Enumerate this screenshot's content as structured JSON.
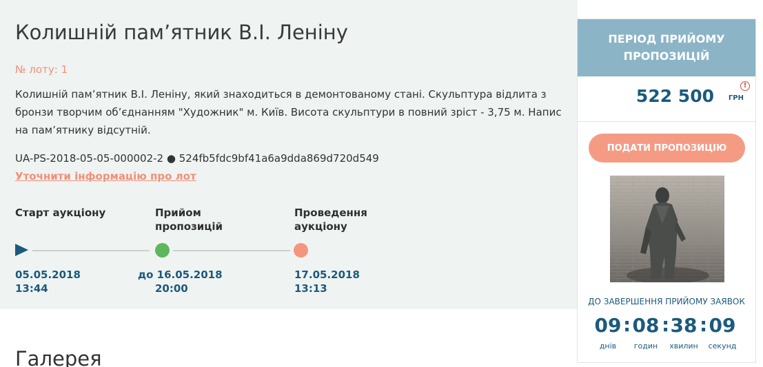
{
  "lot": {
    "title": "Колишній пам’ятник В.І. Леніну",
    "number_text": "№ лоту: 1",
    "description": "Колишній пам’ятник В.І. Леніну, який знаходиться в демонтованому стані. Скульптура відлита з бронзи творчим об’єднанням \"Художник\" м. Київ. Висота скульптури в повний зріст - 3,75 м. Напис на пам’ятнику відсутній.",
    "ids_text": "UA-PS-2018-05-05-000002-2 ● 524fb5fdc9bf41a6a9dda869d720d549",
    "clarify_link": "Уточнити інформацію про лот"
  },
  "timeline": {
    "steps": [
      {
        "label": "Старт аукціону",
        "date": "05.05.2018",
        "time": "13:44",
        "color": "#1b5a7c",
        "icon": "play-icon"
      },
      {
        "label": "Прийом пропозицій",
        "date": "до 16.05.2018",
        "time": "20:00",
        "color": "#5cb85c",
        "icon": "dot-icon"
      },
      {
        "label": "Проведення аукціону",
        "date": "17.05.2018",
        "time": "13:13",
        "color": "#f5957d",
        "icon": "dot-icon"
      }
    ]
  },
  "gallery": {
    "heading": "Галерея"
  },
  "sidebar": {
    "period_title": "ПЕРІОД ПРИЙОМУ ПРОПОЗИЦІЙ",
    "price": "522 500",
    "currency": "ГРН",
    "info_icon": "info-icon",
    "bid_button": "ПОДАТИ ПРОПОЗИЦІЮ",
    "deadline_caption": "ДО ЗАВЕРШЕННЯ ПРИЙОМУ ЗАЯВОК",
    "countdown": {
      "days": "09",
      "days_label": "днів",
      "hours": "08",
      "hours_label": "годин",
      "minutes": "38",
      "minutes_label": "хвилин",
      "seconds": "09",
      "seconds_label": "секунд",
      "separator": ":"
    }
  },
  "colors": {
    "accent": "#1b5a7c",
    "salmon": "#f59b84",
    "header": "#8bb4c6",
    "panel_bg": "#eff3f1"
  }
}
